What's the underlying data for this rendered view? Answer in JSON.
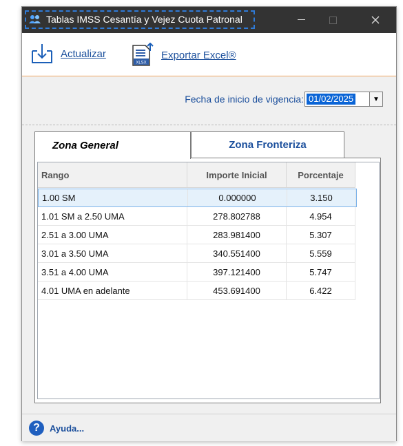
{
  "window": {
    "title": "Tablas IMSS Cesantía y Vejez Cuota Patronal"
  },
  "toolbar": {
    "refresh_label": "Actualizar",
    "export_label": "Exportar Excel®",
    "export_icon_text": "XLSX"
  },
  "filter": {
    "label": "Fecha de inicio de vigencia:",
    "date_value": "01/02/2025"
  },
  "tabs": [
    {
      "label": "Zona General",
      "active": true
    },
    {
      "label": "Zona Fronteriza",
      "active": false
    }
  ],
  "table": {
    "headers": [
      "Rango",
      "Importe Inicial",
      "Porcentaje"
    ],
    "rows": [
      [
        "1.00 SM",
        "0.000000",
        "3.150"
      ],
      [
        "1.01 SM a 2.50 UMA",
        "278.802788",
        "4.954"
      ],
      [
        "2.51 a 3.00 UMA",
        "283.981400",
        "5.307"
      ],
      [
        "3.01 a 3.50 UMA",
        "340.551400",
        "5.559"
      ],
      [
        "3.51 a 4.00 UMA",
        "397.121400",
        "5.747"
      ],
      [
        "4.01 UMA en adelante",
        "453.691400",
        "6.422"
      ]
    ],
    "selected_row": 0
  },
  "status": {
    "help_label": "Ayuda..."
  },
  "icons": {
    "app": "users-icon",
    "refresh": "download-tray-icon",
    "export": "excel-file-icon",
    "help": "help-icon"
  },
  "colors": {
    "title_bar": "#333333",
    "link_blue": "#1b4f9c",
    "selection": "#0a64d6",
    "toolbar_rule": "#f0a35c"
  }
}
